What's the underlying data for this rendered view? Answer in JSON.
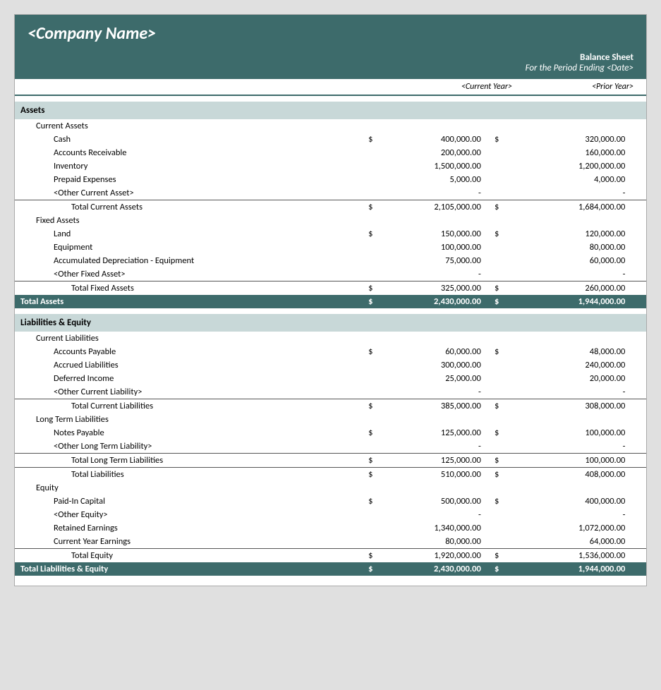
{
  "header": {
    "company_name": "<Company Name>",
    "report_title": "Balance Sheet",
    "report_subtitle": "For the Period Ending <Date>",
    "col_current": "<Current Year>",
    "col_prior": "<Prior Year>"
  },
  "assets": {
    "section_label": "Assets",
    "current_assets": {
      "label": "Current Assets",
      "items": [
        {
          "label": "Cash",
          "dollar": "$",
          "current": "400,000.00",
          "prior_dollar": "$",
          "prior": "320,000.00"
        },
        {
          "label": "Accounts Receivable",
          "dollar": "",
          "current": "200,000.00",
          "prior_dollar": "",
          "prior": "160,000.00"
        },
        {
          "label": "Inventory",
          "dollar": "",
          "current": "1,500,000.00",
          "prior_dollar": "",
          "prior": "1,200,000.00"
        },
        {
          "label": "Prepaid Expenses",
          "dollar": "",
          "current": "5,000.00",
          "prior_dollar": "",
          "prior": "4,000.00"
        },
        {
          "label": "<Other Current Asset>",
          "dollar": "",
          "current": "-",
          "prior_dollar": "",
          "prior": "-"
        }
      ],
      "total_label": "Total Current Assets",
      "total_dollar": "$",
      "total_current": "2,105,000.00",
      "total_prior_dollar": "$",
      "total_prior": "1,684,000.00"
    },
    "fixed_assets": {
      "label": "Fixed Assets",
      "items": [
        {
          "label": "Land",
          "dollar": "$",
          "current": "150,000.00",
          "prior_dollar": "$",
          "prior": "120,000.00"
        },
        {
          "label": "Equipment",
          "dollar": "",
          "current": "100,000.00",
          "prior_dollar": "",
          "prior": "80,000.00"
        },
        {
          "label": "Accumulated Depreciation - Equipment",
          "dollar": "",
          "current": "75,000.00",
          "prior_dollar": "",
          "prior": "60,000.00"
        },
        {
          "label": "<Other Fixed Asset>",
          "dollar": "",
          "current": "-",
          "prior_dollar": "",
          "prior": "-"
        }
      ],
      "total_label": "Total Fixed Assets",
      "total_dollar": "$",
      "total_current": "325,000.00",
      "total_prior_dollar": "$",
      "total_prior": "260,000.00"
    },
    "total_label": "Total Assets",
    "total_dollar": "$",
    "total_current": "2,430,000.00",
    "total_prior_dollar": "$",
    "total_prior": "1,944,000.00"
  },
  "liabilities_equity": {
    "section_label": "Liabilities & Equity",
    "current_liabilities": {
      "label": "Current Liabilities",
      "items": [
        {
          "label": "Accounts Payable",
          "dollar": "$",
          "current": "60,000.00",
          "prior_dollar": "$",
          "prior": "48,000.00"
        },
        {
          "label": "Accrued Liabilities",
          "dollar": "",
          "current": "300,000.00",
          "prior_dollar": "",
          "prior": "240,000.00"
        },
        {
          "label": "Deferred Income",
          "dollar": "",
          "current": "25,000.00",
          "prior_dollar": "",
          "prior": "20,000.00"
        },
        {
          "label": "<Other Current Liability>",
          "dollar": "",
          "current": "-",
          "prior_dollar": "",
          "prior": "-"
        }
      ],
      "total_label": "Total Current Liabilities",
      "total_dollar": "$",
      "total_current": "385,000.00",
      "total_prior_dollar": "$",
      "total_prior": "308,000.00"
    },
    "long_term_liabilities": {
      "label": "Long Term Liabilities",
      "items": [
        {
          "label": "Notes Payable",
          "dollar": "$",
          "current": "125,000.00",
          "prior_dollar": "$",
          "prior": "100,000.00"
        },
        {
          "label": "<Other Long Term Liability>",
          "dollar": "",
          "current": "-",
          "prior_dollar": "",
          "prior": "-"
        }
      ],
      "total_label": "Total Long Term Liabilities",
      "total_dollar": "$",
      "total_current": "125,000.00",
      "total_prior_dollar": "$",
      "total_prior": "100,000.00"
    },
    "total_liabilities_label": "Total Liabilities",
    "total_liabilities_dollar": "$",
    "total_liabilities_current": "510,000.00",
    "total_liabilities_prior_dollar": "$",
    "total_liabilities_prior": "408,000.00",
    "equity": {
      "label": "Equity",
      "items": [
        {
          "label": "Paid-In Capital",
          "dollar": "$",
          "current": "500,000.00",
          "prior_dollar": "$",
          "prior": "400,000.00"
        },
        {
          "label": "<Other Equity>",
          "dollar": "",
          "current": "-",
          "prior_dollar": "",
          "prior": "-"
        },
        {
          "label": "Retained Earnings",
          "dollar": "",
          "current": "1,340,000.00",
          "prior_dollar": "",
          "prior": "1,072,000.00"
        },
        {
          "label": "Current Year Earnings",
          "dollar": "",
          "current": "80,000.00",
          "prior_dollar": "",
          "prior": "64,000.00"
        }
      ],
      "total_label": "Total Equity",
      "total_dollar": "$",
      "total_current": "1,920,000.00",
      "total_prior_dollar": "$",
      "total_prior": "1,536,000.00"
    },
    "total_label": "Total Liabilities & Equity",
    "total_dollar": "$",
    "total_current": "2,430,000.00",
    "total_prior_dollar": "$",
    "total_prior": "1,944,000.00"
  }
}
